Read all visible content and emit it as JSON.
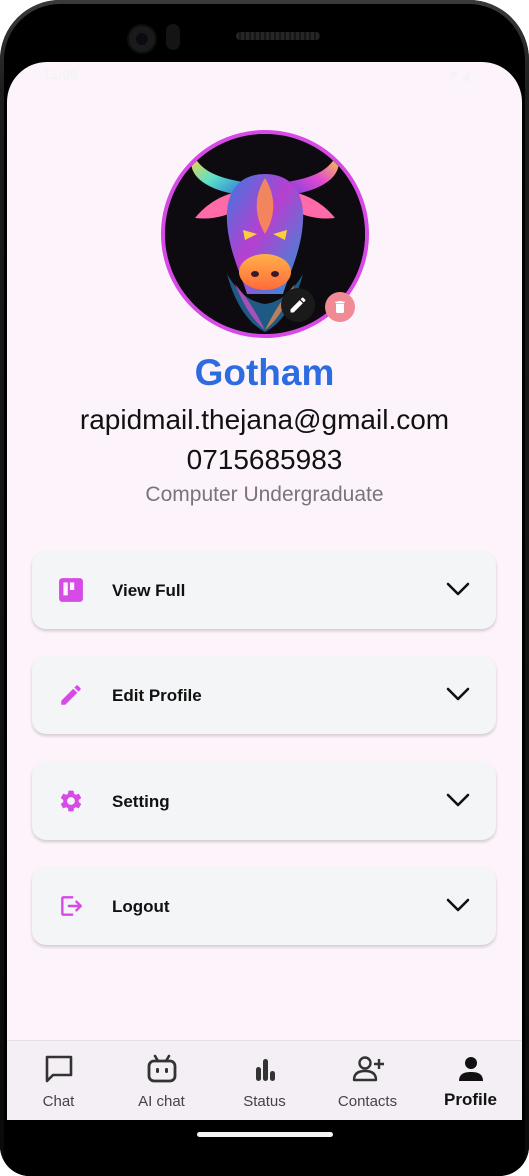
{
  "status_bar": {
    "time": "11:00",
    "icons": "▼◢"
  },
  "profile": {
    "name": "Gotham",
    "email": "rapidmail.thejana@gmail.com",
    "phone": "0715685983",
    "role": "Computer Undergraduate"
  },
  "menu": [
    {
      "label": "View Full",
      "icon": "trello-board-icon"
    },
    {
      "label": "Edit Profile",
      "icon": "pencil-icon"
    },
    {
      "label": "Setting",
      "icon": "gear-icon"
    },
    {
      "label": "Logout",
      "icon": "logout-icon"
    }
  ],
  "nav": [
    {
      "label": "Chat",
      "icon": "chat-bubble-icon"
    },
    {
      "label": "AI chat",
      "icon": "robot-icon"
    },
    {
      "label": "Status",
      "icon": "bar-chart-icon"
    },
    {
      "label": "Contacts",
      "icon": "add-person-icon"
    },
    {
      "label": "Profile",
      "icon": "person-icon",
      "active": true
    }
  ],
  "colors": {
    "accent": "#d64ae6",
    "name": "#2d6be0",
    "screen_bg": "#fdf4fb",
    "card_bg": "#f4f5f6"
  }
}
